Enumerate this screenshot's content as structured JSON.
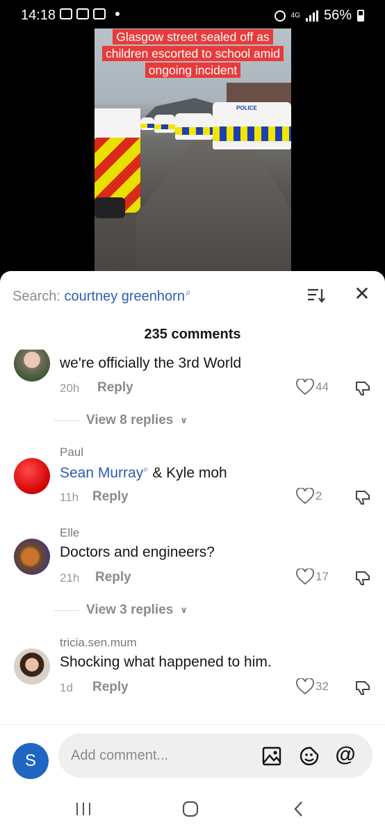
{
  "status_bar": {
    "time": "14:18",
    "network": "4G",
    "battery": "56%"
  },
  "video": {
    "headline": "Glasgow street sealed off as children escorted to school amid ongoing incident",
    "van_label": "POLICE"
  },
  "sheet": {
    "search_prefix": "Search:",
    "search_term": "courtney greenhorn",
    "comment_count": "235 comments"
  },
  "comments": [
    {
      "user": "",
      "text": "we're officially the 3rd World",
      "time": "20h",
      "reply": "Reply",
      "likes": "44",
      "view_replies": "View 8 replies"
    },
    {
      "user": "Paul",
      "mention": "Sean Murray",
      "text": " & Kyle moh",
      "time": "11h",
      "reply": "Reply",
      "likes": "2"
    },
    {
      "user": "Elle",
      "text": "Doctors and engineers?",
      "time": "21h",
      "reply": "Reply",
      "likes": "17",
      "view_replies": "View 3 replies"
    },
    {
      "user": "tricia.sen.mum",
      "text": "Shocking what happened to him.",
      "time": "1d",
      "reply": "Reply",
      "likes": "32"
    }
  ],
  "input": {
    "avatar_letter": "S",
    "placeholder": "Add comment..."
  },
  "icons": {
    "sort": "sort-icon",
    "close": "close-icon",
    "heart": "heart-icon",
    "dislike": "dislike-icon",
    "image": "image-icon",
    "emoji": "emoji-icon",
    "mention": "at-icon",
    "nav_recent": "recent-apps-icon",
    "nav_home": "home-icon",
    "nav_back": "back-icon"
  },
  "colors": {
    "accent": "#2b5db5",
    "headline_bg": "#e83b3b",
    "me_avatar": "#1f66c2"
  }
}
